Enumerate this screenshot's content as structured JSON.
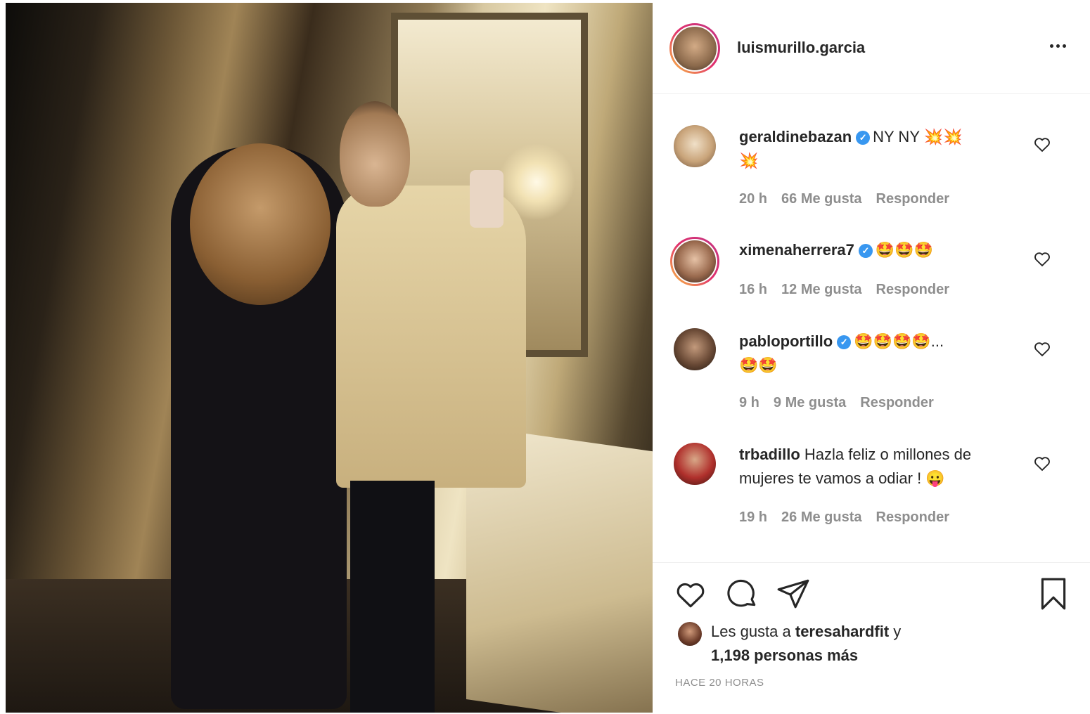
{
  "post": {
    "username": "luismurillo.garcia"
  },
  "comments": [
    {
      "username": "geraldinebazan",
      "verified": true,
      "text": "NY NY 💥💥",
      "text2": "💥",
      "time": "20 h",
      "likes": "66 Me gusta",
      "reply": "Responder"
    },
    {
      "username": "ximenaherrera7",
      "verified": true,
      "text": "🤩🤩🤩",
      "time": "16 h",
      "likes": "12 Me gusta",
      "reply": "Responder"
    },
    {
      "username": "pabloportillo",
      "verified": true,
      "text": "🤩🤩🤩🤩...",
      "text2": "🤩🤩",
      "time": "9 h",
      "likes": "9 Me gusta",
      "reply": "Responder"
    },
    {
      "username": "trbadillo",
      "verified": false,
      "text": "Hazla feliz o millones de mujeres te vamos a odiar ! 😛",
      "time": "19 h",
      "likes": "26 Me gusta",
      "reply": "Responder"
    }
  ],
  "likes": {
    "prefix": "Les gusta a",
    "user": "teresahardfit",
    "suffix": "y",
    "others": "1,198 personas más"
  },
  "timestamp": "HACE 20 HORAS",
  "icons": [
    "more-icon",
    "heart-icon",
    "comment-icon",
    "share-icon",
    "bookmark-icon"
  ],
  "colors": {
    "verified": "#3897f0",
    "meta_text": "#8e8e8e",
    "primary_text": "#262626"
  }
}
